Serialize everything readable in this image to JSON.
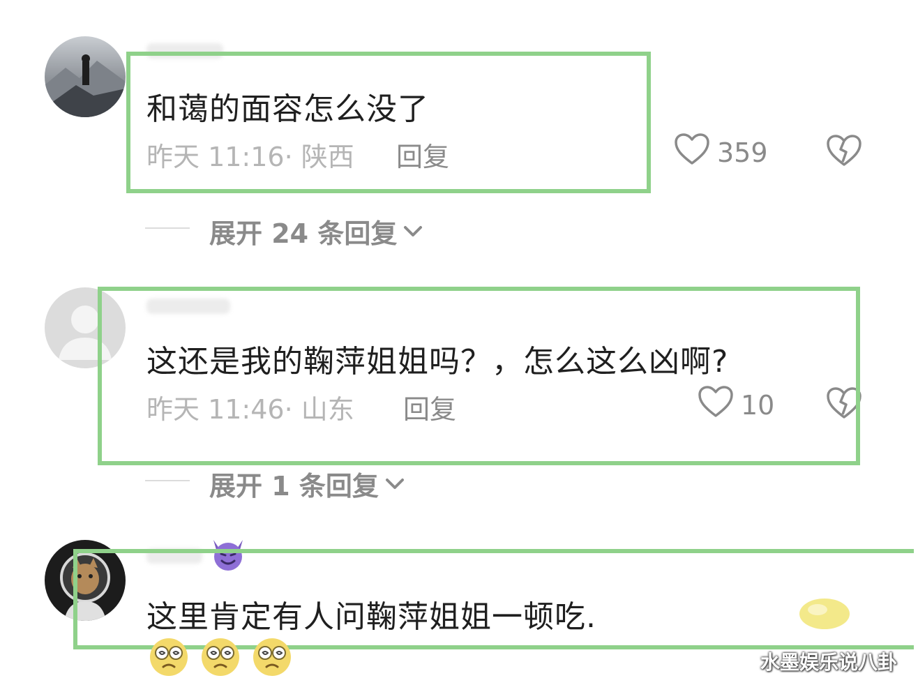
{
  "comments": [
    {
      "text": "和蔼的面容怎么没了",
      "meta": "昨天 11:16· 陕西",
      "reply_label": "回复",
      "likes": "359",
      "expand_label": "展开 24 条回复"
    },
    {
      "text": "这还是我的鞠萍姐姐吗？，怎么这么凶啊?",
      "meta": "昨天 11:46· 山东",
      "reply_label": "回复",
      "likes": "10",
      "expand_label": "展开 1 条回复"
    },
    {
      "text": "这里肯定有人问鞠萍姐姐一顿吃.",
      "emojis": [
        "dizzy-face-emoji",
        "dizzy-face-emoji",
        "dizzy-face-emoji"
      ]
    }
  ],
  "watermark": "水墨娱乐说八卦",
  "colors": {
    "highlight": "#8fd18a",
    "meta_text": "#b5b5b5",
    "action_text": "#8a8a8a"
  },
  "icons": [
    "heart-outline-icon",
    "broken-heart-icon",
    "chevron-down-icon"
  ]
}
